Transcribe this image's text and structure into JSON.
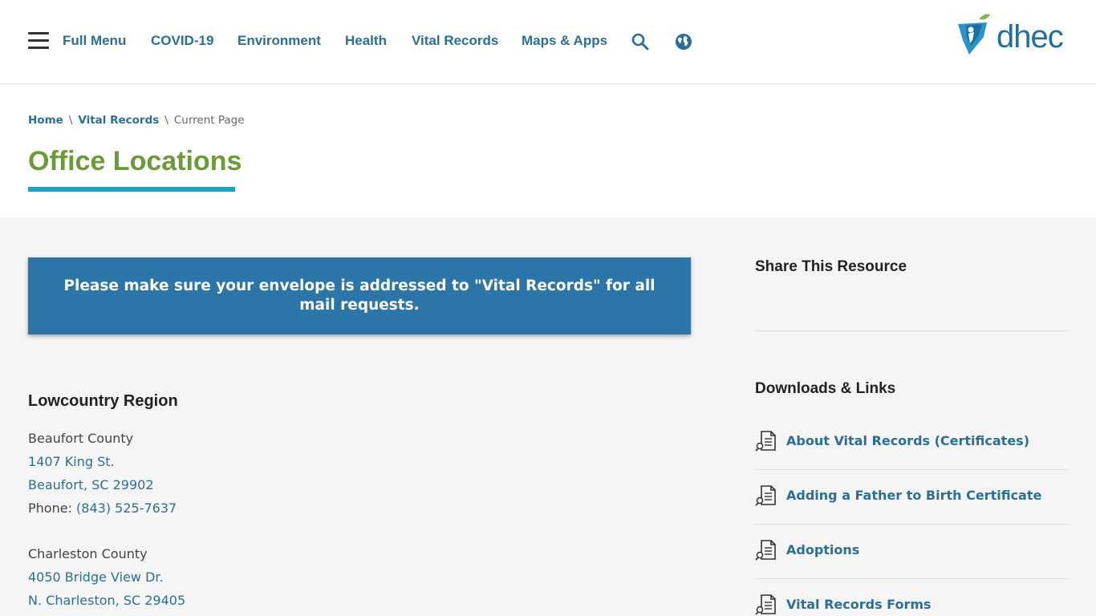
{
  "header": {
    "nav": [
      "Full Menu",
      "COVID-19",
      "Environment",
      "Health",
      "Vital Records",
      "Maps & Apps"
    ],
    "logo_text": "dhec"
  },
  "breadcrumb": {
    "home": "Home",
    "separator": "\\",
    "section": "Vital Records",
    "current": "Current Page"
  },
  "page_title": "Office Locations",
  "notice": "Please make sure your envelope is addressed to \"Vital Records\" for all mail requests.",
  "region": {
    "title": "Lowcountry Region",
    "counties": [
      {
        "name": "Beaufort County",
        "address_line1": "1407 King St.",
        "address_line2": "Beaufort, SC 29902",
        "phone_label": "Phone: ",
        "phone": "(843) 525-7637"
      },
      {
        "name": "Charleston County",
        "address_line1": "4050 Bridge View Dr.",
        "address_line2": "N. Charleston, SC 29405"
      }
    ]
  },
  "sidebar": {
    "share_heading": "Share This Resource",
    "downloads_heading": "Downloads & Links",
    "links": [
      "About Vital Records (Certificates)",
      "Adding a Father to Birth Certificate",
      "Adoptions",
      "Vital Records Forms"
    ]
  },
  "colors": {
    "nav_link": "#2a6f97",
    "title_green": "#6b9b37",
    "underline_blue": "#1ba3cf",
    "notice_bg": "#2b75a8"
  },
  "icons": [
    "menu-icon",
    "search-icon",
    "globe-icon",
    "document-icon"
  ]
}
